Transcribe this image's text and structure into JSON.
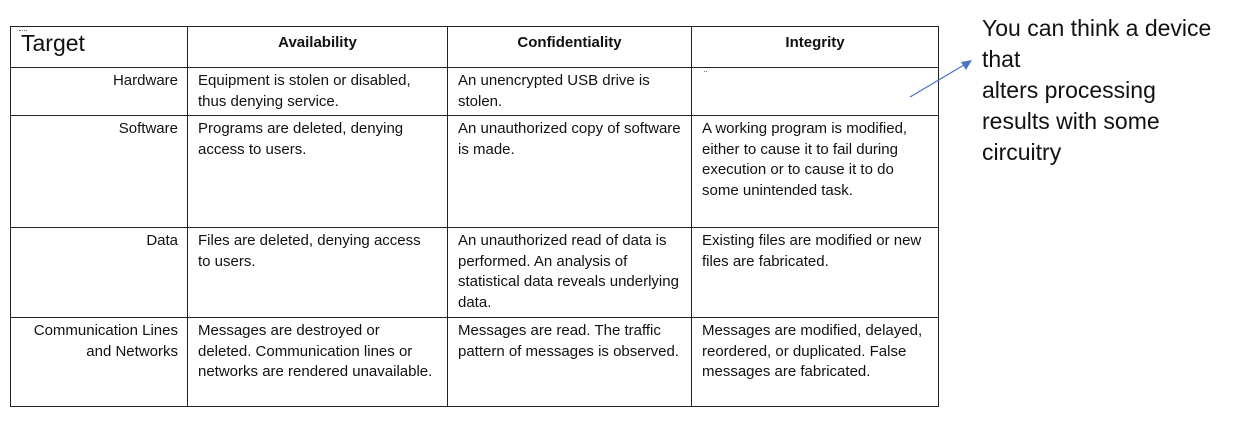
{
  "table": {
    "header": {
      "target": "Target",
      "availability": "Availability",
      "confidentiality": "Confidentiality",
      "integrity": "Integrity"
    },
    "rows": [
      {
        "target": "Hardware",
        "availability": "Equipment is stolen or disabled, thus denying service.",
        "confidentiality": "An unencrypted USB drive is stolen.",
        "integrity": ""
      },
      {
        "target": "Software",
        "availability": "Programs are deleted, denying access to users.",
        "confidentiality": "An unauthorized copy of software is made.",
        "integrity": "A working program is modified, either to cause it to fail during execution or to cause it to do some unintended task."
      },
      {
        "target": "Data",
        "availability": "Files are deleted, denying access to users.",
        "confidentiality": "An unauthorized read of data is performed. An analysis of statistical data reveals underlying data.",
        "integrity": "Existing files are modified or new files are fabricated."
      },
      {
        "target": "Communication Lines and Networks",
        "availability": "Messages are destroyed or deleted. Communication lines or networks are rendered unavailable.",
        "confidentiality": "Messages are read. The traffic pattern of messages is observed.",
        "integrity": "Messages are modified, delayed, reordered, or duplicated. False messages are fabricated."
      }
    ]
  },
  "annotation": {
    "lines": [
      "You can think a device",
      "that",
      "alters processing",
      "results with some",
      "circuitry"
    ],
    "arrow_color": "#4a72c4"
  }
}
